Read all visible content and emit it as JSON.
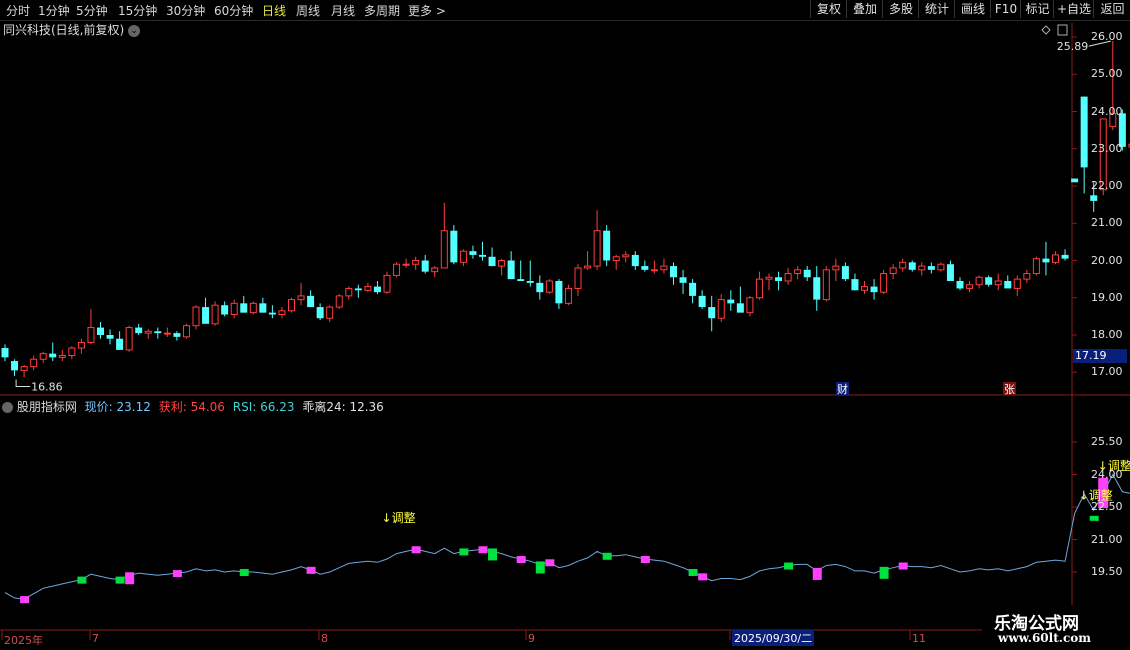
{
  "toolbar": {
    "periods": [
      "分时",
      "1分钟",
      "5分钟",
      "15分钟",
      "30分钟",
      "60分钟",
      "日线",
      "周线",
      "月线",
      "多周期",
      "更多 >"
    ],
    "active_period": "日线",
    "right_buttons": [
      "复权",
      "叠加",
      "多股",
      "统计",
      "画线",
      "F10",
      "标记",
      "+自选",
      "返回"
    ]
  },
  "upper": {
    "title": "同兴科技(日线,前复权)",
    "high_label": "25.89",
    "low_label": "16.86",
    "current_price_tag": "17.19",
    "marker_cai": "财",
    "marker_zhang": "张"
  },
  "indicator": {
    "name": "股朋指标网",
    "price_label": "现价: 23.12",
    "profit_label": "获利: 54.06",
    "rsi_label": "RSI: 66.23",
    "bias_label": "乖离24: 12.36",
    "signal_text": "↓调整"
  },
  "xaxis": {
    "labels": [
      "2025年",
      "7",
      "8",
      "9",
      "2025/09/30/二",
      "11"
    ]
  },
  "watermark": {
    "line1": "乐淘公式网",
    "line2": "www.60lt.com"
  },
  "colors": {
    "up": "#ff3c3c",
    "down": "#54ffff",
    "ma_line": "#6fa8dc",
    "grid": "#8b1a1a",
    "magenta": "#ff40ff",
    "green": "#00e040",
    "yellow": "#ffff40"
  },
  "chart_data": {
    "type": "candlestick",
    "ylim": [
      16.6,
      26.3
    ],
    "yticks": [
      17.0,
      18.0,
      19.0,
      20.0,
      21.0,
      22.0,
      23.0,
      24.0,
      25.0,
      26.0
    ],
    "ohlc": [
      [
        17.65,
        17.75,
        17.3,
        17.4
      ],
      [
        17.3,
        17.35,
        16.9,
        17.05
      ],
      [
        17.05,
        17.2,
        16.86,
        17.15
      ],
      [
        17.15,
        17.45,
        17.05,
        17.35
      ],
      [
        17.35,
        17.55,
        17.25,
        17.5
      ],
      [
        17.5,
        17.8,
        17.3,
        17.4
      ],
      [
        17.4,
        17.6,
        17.3,
        17.45
      ],
      [
        17.45,
        17.7,
        17.35,
        17.65
      ],
      [
        17.65,
        17.9,
        17.5,
        17.8
      ],
      [
        17.8,
        18.7,
        17.75,
        18.2
      ],
      [
        18.2,
        18.35,
        17.9,
        18.0
      ],
      [
        18.0,
        18.15,
        17.75,
        17.9
      ],
      [
        17.9,
        18.1,
        17.6,
        17.6
      ],
      [
        17.6,
        18.25,
        17.55,
        18.2
      ],
      [
        18.2,
        18.3,
        18.0,
        18.05
      ],
      [
        18.05,
        18.15,
        17.9,
        18.1
      ],
      [
        18.1,
        18.2,
        17.9,
        18.05
      ],
      [
        18.05,
        18.2,
        17.95,
        18.05
      ],
      [
        18.05,
        18.1,
        17.85,
        17.95
      ],
      [
        17.95,
        18.3,
        17.9,
        18.25
      ],
      [
        18.25,
        18.8,
        18.15,
        18.75
      ],
      [
        18.75,
        19.0,
        18.35,
        18.3
      ],
      [
        18.3,
        18.9,
        18.25,
        18.8
      ],
      [
        18.8,
        18.9,
        18.5,
        18.55
      ],
      [
        18.55,
        18.95,
        18.45,
        18.85
      ],
      [
        18.85,
        19.05,
        18.6,
        18.6
      ],
      [
        18.6,
        18.9,
        18.55,
        18.85
      ],
      [
        18.85,
        19.0,
        18.6,
        18.6
      ],
      [
        18.6,
        18.8,
        18.45,
        18.55
      ],
      [
        18.55,
        18.75,
        18.45,
        18.65
      ],
      [
        18.65,
        19.0,
        18.6,
        18.95
      ],
      [
        18.95,
        19.4,
        18.8,
        19.05
      ],
      [
        19.05,
        19.2,
        18.75,
        18.75
      ],
      [
        18.75,
        18.85,
        18.4,
        18.45
      ],
      [
        18.45,
        18.8,
        18.35,
        18.75
      ],
      [
        18.75,
        19.1,
        18.7,
        19.05
      ],
      [
        19.05,
        19.3,
        18.95,
        19.25
      ],
      [
        19.25,
        19.35,
        19.0,
        19.2
      ],
      [
        19.2,
        19.4,
        19.15,
        19.3
      ],
      [
        19.3,
        19.45,
        19.1,
        19.15
      ],
      [
        19.15,
        19.7,
        19.1,
        19.6
      ],
      [
        19.6,
        19.95,
        19.55,
        19.9
      ],
      [
        19.9,
        20.05,
        19.8,
        19.9
      ],
      [
        19.9,
        20.1,
        19.75,
        20.0
      ],
      [
        20.0,
        20.15,
        19.65,
        19.7
      ],
      [
        19.7,
        19.85,
        19.55,
        19.8
      ],
      [
        19.8,
        21.55,
        19.9,
        20.8
      ],
      [
        20.8,
        20.95,
        19.9,
        19.95
      ],
      [
        19.95,
        20.3,
        19.85,
        20.25
      ],
      [
        20.25,
        20.4,
        20.05,
        20.15
      ],
      [
        20.15,
        20.5,
        20.0,
        20.1
      ],
      [
        20.1,
        20.35,
        19.85,
        19.85
      ],
      [
        19.85,
        20.05,
        19.6,
        20.0
      ],
      [
        20.0,
        20.25,
        19.55,
        19.5
      ],
      [
        19.5,
        20.0,
        19.45,
        19.45
      ],
      [
        19.45,
        20.0,
        19.3,
        19.4
      ],
      [
        19.4,
        19.6,
        18.95,
        19.15
      ],
      [
        19.15,
        19.5,
        19.1,
        19.45
      ],
      [
        19.45,
        19.5,
        18.7,
        18.85
      ],
      [
        18.85,
        19.35,
        18.8,
        19.25
      ],
      [
        19.25,
        19.9,
        19.05,
        19.8
      ],
      [
        19.8,
        20.25,
        19.75,
        19.85
      ],
      [
        19.85,
        21.35,
        19.75,
        20.8
      ],
      [
        20.8,
        20.95,
        19.85,
        20.0
      ],
      [
        20.0,
        20.15,
        19.75,
        20.1
      ],
      [
        20.1,
        20.25,
        19.95,
        20.15
      ],
      [
        20.15,
        20.25,
        19.75,
        19.85
      ],
      [
        19.85,
        20.0,
        19.7,
        19.75
      ],
      [
        19.75,
        20.0,
        19.65,
        19.75
      ],
      [
        19.75,
        20.05,
        19.65,
        19.85
      ],
      [
        19.85,
        19.95,
        19.35,
        19.55
      ],
      [
        19.55,
        19.75,
        19.1,
        19.4
      ],
      [
        19.4,
        19.5,
        18.85,
        19.05
      ],
      [
        19.05,
        19.2,
        18.7,
        18.75
      ],
      [
        18.75,
        19.05,
        18.1,
        18.45
      ],
      [
        18.45,
        19.1,
        18.35,
        18.95
      ],
      [
        18.95,
        19.2,
        18.65,
        18.85
      ],
      [
        18.85,
        19.3,
        18.7,
        18.6
      ],
      [
        18.6,
        19.05,
        18.5,
        19.0
      ],
      [
        19.0,
        19.7,
        18.95,
        19.5
      ],
      [
        19.5,
        19.65,
        19.2,
        19.55
      ],
      [
        19.55,
        19.7,
        19.2,
        19.45
      ],
      [
        19.45,
        19.8,
        19.35,
        19.65
      ],
      [
        19.65,
        19.85,
        19.5,
        19.75
      ],
      [
        19.75,
        19.85,
        19.45,
        19.55
      ],
      [
        19.55,
        19.85,
        18.65,
        18.95
      ],
      [
        18.95,
        19.85,
        18.9,
        19.75
      ],
      [
        19.75,
        20.05,
        19.45,
        19.85
      ],
      [
        19.85,
        19.95,
        19.45,
        19.5
      ],
      [
        19.5,
        19.65,
        19.2,
        19.2
      ],
      [
        19.2,
        19.45,
        19.1,
        19.3
      ],
      [
        19.3,
        19.5,
        18.95,
        19.15
      ],
      [
        19.15,
        19.75,
        19.1,
        19.65
      ],
      [
        19.65,
        19.9,
        19.5,
        19.8
      ],
      [
        19.8,
        20.05,
        19.7,
        19.95
      ],
      [
        19.95,
        20.0,
        19.7,
        19.75
      ],
      [
        19.75,
        19.95,
        19.6,
        19.85
      ],
      [
        19.85,
        19.95,
        19.65,
        19.75
      ],
      [
        19.75,
        19.95,
        19.7,
        19.9
      ],
      [
        19.9,
        20.0,
        19.5,
        19.45
      ],
      [
        19.45,
        19.55,
        19.2,
        19.25
      ],
      [
        19.25,
        19.45,
        19.15,
        19.35
      ],
      [
        19.35,
        19.6,
        19.25,
        19.55
      ],
      [
        19.55,
        19.6,
        19.3,
        19.35
      ],
      [
        19.35,
        19.65,
        19.2,
        19.45
      ],
      [
        19.45,
        19.6,
        19.3,
        19.25
      ],
      [
        19.25,
        19.6,
        19.05,
        19.5
      ],
      [
        19.5,
        19.75,
        19.4,
        19.65
      ],
      [
        19.65,
        20.1,
        19.6,
        20.05
      ],
      [
        20.05,
        20.5,
        19.6,
        19.95
      ],
      [
        19.95,
        20.25,
        19.9,
        20.15
      ],
      [
        20.15,
        20.3,
        20.0,
        20.05
      ],
      [
        22.2,
        22.2,
        22.1,
        22.1
      ],
      [
        24.4,
        24.4,
        21.8,
        22.5
      ],
      [
        21.75,
        22.1,
        21.3,
        21.6
      ],
      [
        21.9,
        23.8,
        21.75,
        23.8
      ],
      [
        23.6,
        25.89,
        23.5,
        23.95
      ],
      [
        23.95,
        24.05,
        22.95,
        23.05
      ],
      [
        23.05,
        24.75,
        22.95,
        23.12
      ]
    ],
    "indicator": {
      "ylim": [
        18.2,
        27.0
      ],
      "yticks": [
        19.5,
        21.0,
        22.5,
        24.0,
        25.5
      ],
      "line": [
        18.55,
        18.3,
        18.25,
        18.5,
        18.75,
        18.85,
        18.95,
        19.05,
        19.15,
        19.4,
        19.3,
        19.2,
        19.15,
        19.35,
        19.45,
        19.4,
        19.35,
        19.4,
        19.45,
        19.5,
        19.65,
        19.55,
        19.6,
        19.5,
        19.55,
        19.5,
        19.5,
        19.45,
        19.4,
        19.5,
        19.6,
        19.75,
        19.6,
        19.4,
        19.5,
        19.7,
        19.9,
        19.95,
        20.0,
        19.95,
        20.1,
        20.35,
        20.45,
        20.55,
        20.45,
        20.35,
        20.6,
        20.35,
        20.45,
        20.5,
        20.55,
        20.45,
        20.35,
        20.2,
        20.1,
        20.0,
        19.85,
        19.95,
        19.7,
        19.8,
        20.0,
        20.15,
        20.45,
        20.25,
        20.25,
        20.3,
        20.2,
        20.1,
        20.05,
        20.0,
        19.85,
        19.7,
        19.5,
        19.3,
        19.1,
        19.2,
        19.2,
        19.15,
        19.3,
        19.55,
        19.65,
        19.7,
        19.8,
        19.85,
        19.85,
        19.55,
        19.8,
        19.85,
        19.75,
        19.55,
        19.55,
        19.45,
        19.6,
        19.7,
        19.8,
        19.75,
        19.75,
        19.7,
        19.8,
        19.65,
        19.5,
        19.55,
        19.65,
        19.6,
        19.65,
        19.55,
        19.65,
        19.75,
        19.95,
        20.0,
        20.05,
        20.0,
        22.2,
        23.1,
        22.35,
        23.15,
        24.0,
        23.2,
        23.12
      ]
    }
  }
}
